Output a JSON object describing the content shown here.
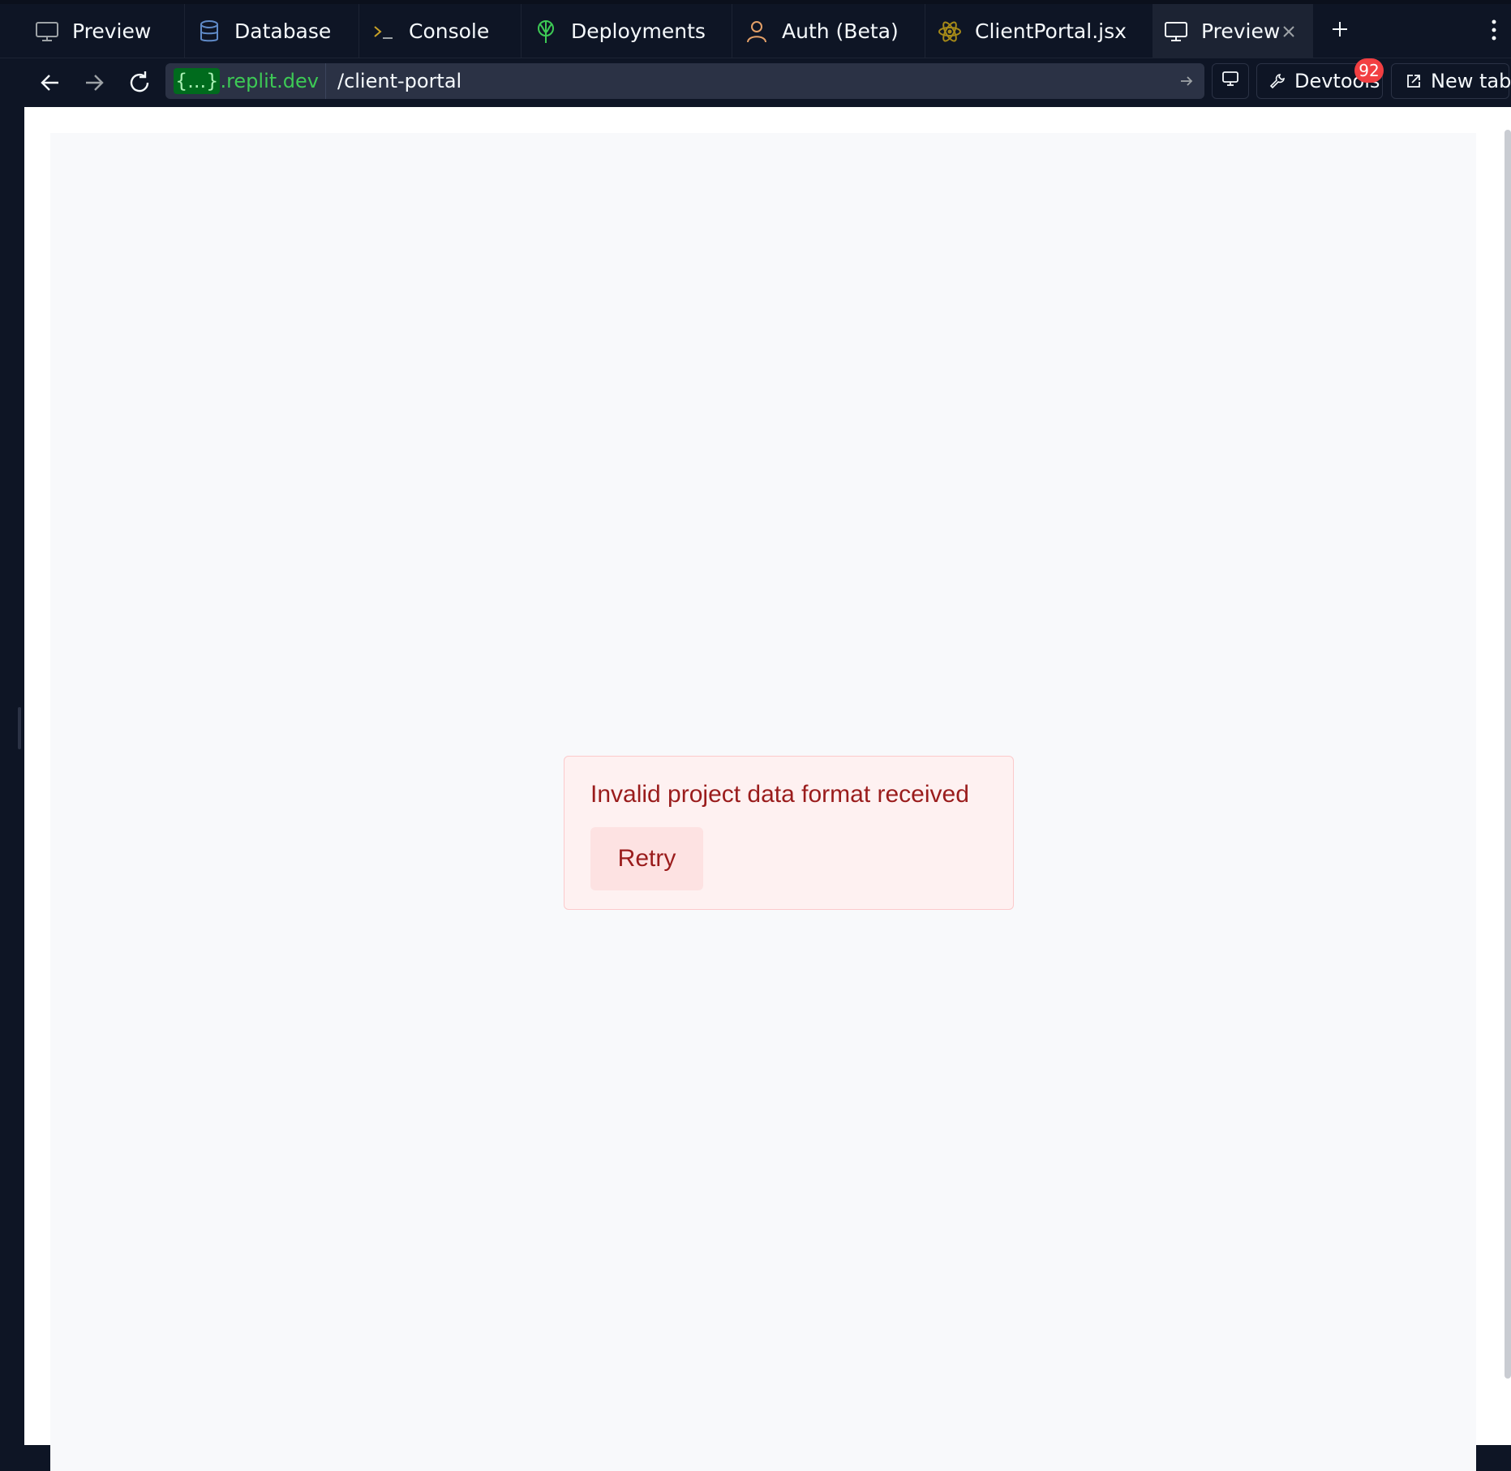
{
  "tabs": [
    {
      "label": "Preview",
      "icon": "monitor-icon"
    },
    {
      "label": "Database",
      "icon": "database-icon"
    },
    {
      "label": "Console",
      "icon": "terminal-icon"
    },
    {
      "label": "Deployments",
      "icon": "deployments-icon"
    },
    {
      "label": "Auth (Beta)",
      "icon": "user-icon"
    },
    {
      "label": "ClientPortal.jsx",
      "icon": "react-icon"
    },
    {
      "label": "Preview",
      "icon": "monitor-icon",
      "active": true
    }
  ],
  "address_bar": {
    "host_chip": "{...}",
    "host_domain": ".replit.dev",
    "path": "/client-portal"
  },
  "toolbar": {
    "devtools_label": "Devtools",
    "devtools_badge": "92",
    "new_tab_label": "New tab"
  },
  "error": {
    "message": "Invalid project data format received",
    "retry_label": "Retry"
  },
  "colors": {
    "ide_background": "#0e1525",
    "url_host": "#3dca55",
    "error_text": "#9a1c1c",
    "error_background": "#fef1f1",
    "badge": "#f23f42"
  }
}
